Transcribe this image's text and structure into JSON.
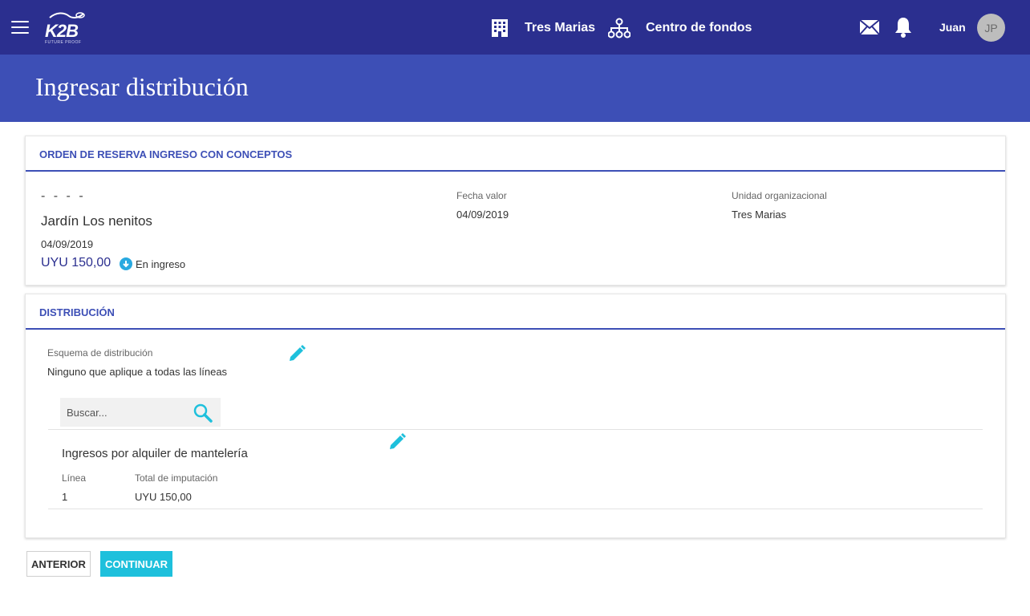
{
  "header": {
    "logo_text": "K2B",
    "logo_subtitle": "FUTURE PROOF",
    "organization_label": "Tres Marias",
    "fund_center_label": "Centro de fondos",
    "user_name": "Juan",
    "avatar_initials": "JP",
    "accent_color": "#2b2f8f"
  },
  "page": {
    "title": "Ingresar distribución"
  },
  "order_card": {
    "heading": "ORDEN DE RESERVA INGRESO CON CONCEPTOS",
    "identifier": "- - - -",
    "entity_name": "Jardín Los nenitos",
    "date": "04/09/2019",
    "amount": "UYU 150,00",
    "status_text": "En ingreso",
    "fecha_valor_label": "Fecha valor",
    "fecha_valor_value": "04/09/2019",
    "unidad_label": "Unidad organizacional",
    "unidad_value": "Tres Marias"
  },
  "distribution_card": {
    "heading": "DISTRIBUCIÓN",
    "scheme_label": "Esquema de distribución",
    "scheme_value": "Ninguno que aplique a todas las líneas",
    "search_placeholder": "Buscar...",
    "line_title": "Ingresos por alquiler de mantelería",
    "columns": [
      "Línea",
      "Total de imputación"
    ],
    "rows": [
      [
        "1",
        "UYU 150,00"
      ]
    ]
  },
  "actions": {
    "previous_label": "ANTERIOR",
    "continue_label": "CONTINUAR",
    "continue_color": "#1ec0dc"
  }
}
